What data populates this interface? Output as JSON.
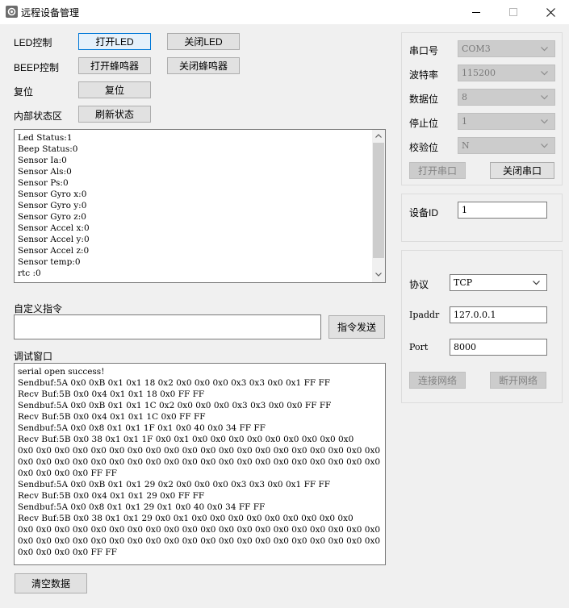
{
  "window": {
    "title": "远程设备管理",
    "colors": {
      "accent": "#0078d7",
      "face": "#f0f0f0"
    }
  },
  "controls": {
    "led_label": "LED控制",
    "led_on": "打开LED",
    "led_off": "关闭LED",
    "beep_label": "BEEP控制",
    "beep_on": "打开蜂鸣器",
    "beep_off": "关闭蜂鸣器",
    "reset_label": "复位",
    "reset_button": "复位",
    "status_label": "内部状态区",
    "refresh_button": "刷新状态"
  },
  "status_lines": [
    "Led Status:1",
    "Beep Status:0",
    "Sensor Ia:0",
    "Sensor Als:0",
    "Sensor Ps:0",
    "Sensor Gyro x:0",
    "Sensor Gyro y:0",
    "Sensor Gyro z:0",
    "Sensor Accel x:0",
    "Sensor Accel y:0",
    "Sensor Accel z:0",
    "Sensor temp:0",
    "rtc :0"
  ],
  "custom_command": {
    "label": "自定义指令",
    "value": "",
    "send_button": "指令发送"
  },
  "debug": {
    "label": "调试窗口",
    "lines": [
      "serial open success!",
      "Sendbuf:5A 0x0 0xB 0x1 0x1 18 0x2 0x0 0x0 0x0 0x3 0x3 0x0 0x1 FF FF",
      "Recv Buf:5B 0x0 0x4 0x1 0x1 18 0x0 FF FF",
      "Sendbuf:5A 0x0 0xB 0x1 0x1 1C 0x2 0x0 0x0 0x0 0x3 0x3 0x0 0x0 FF FF",
      "Recv Buf:5B 0x0 0x4 0x1 0x1 1C 0x0 FF FF",
      "Sendbuf:5A 0x0 0x8 0x1 0x1 1F 0x1 0x0 40 0x0 34 FF FF",
      "Recv Buf:5B 0x0 38 0x1 0x1 1F 0x0 0x1 0x0 0x0 0x0 0x0 0x0 0x0 0x0 0x0 0x0",
      "0x0 0x0 0x0 0x0 0x0 0x0 0x0 0x0 0x0 0x0 0x0 0x0 0x0 0x0 0x0 0x0 0x0 0x0 0x0 0x0",
      "0x0 0x0 0x0 0x0 0x0 0x0 0x0 0x0 0x0 0x0 0x0 0x0 0x0 0x0 0x0 0x0 0x0 0x0 0x0 0x0",
      "0x0 0x0 0x0 0x0 FF FF",
      "Sendbuf:5A 0x0 0xB 0x1 0x1 29 0x2 0x0 0x0 0x0 0x3 0x3 0x0 0x1 FF FF",
      "Recv Buf:5B 0x0 0x4 0x1 0x1 29 0x0 FF FF",
      "Sendbuf:5A 0x0 0x8 0x1 0x1 29 0x1 0x0 40 0x0 34 FF FF",
      "Recv Buf:5B 0x0 38 0x1 0x1 29 0x0 0x1 0x0 0x0 0x0 0x0 0x0 0x0 0x0 0x0 0x0",
      "0x0 0x0 0x0 0x0 0x0 0x0 0x0 0x0 0x0 0x0 0x0 0x0 0x0 0x0 0x0 0x0 0x0 0x0 0x0 0x0",
      "0x0 0x0 0x0 0x0 0x0 0x0 0x0 0x0 0x0 0x0 0x0 0x0 0x0 0x0 0x0 0x0 0x0 0x0 0x0 0x0",
      "0x0 0x0 0x0 0x0 FF FF"
    ],
    "clear_button": "清空数据"
  },
  "serial": {
    "port_label": "串口号",
    "port_value": "COM3",
    "baud_label": "波特率",
    "baud_value": "115200",
    "databits_label": "数据位",
    "databits_value": "8",
    "stopbits_label": "停止位",
    "stopbits_value": "1",
    "parity_label": "校验位",
    "parity_value": "N",
    "open_button": "打开串口",
    "close_button": "关闭串口"
  },
  "device": {
    "id_label": "设备ID",
    "id_value": "1"
  },
  "network": {
    "protocol_label": "协议",
    "protocol_value": "TCP",
    "ip_label": "Ipaddr",
    "ip_value": "127.0.0.1",
    "port_label": "Port",
    "port_value": "8000",
    "connect_button": "连接网络",
    "disconnect_button": "断开网络"
  }
}
